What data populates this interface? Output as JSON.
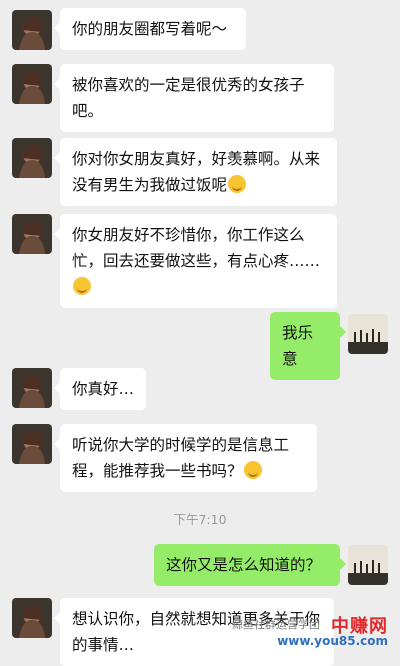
{
  "messages": [
    {
      "side": "in",
      "text": "你的朋友圈都写着呢～"
    },
    {
      "side": "in",
      "text": "被你喜欢的一定是很优秀的女孩子吧。"
    },
    {
      "side": "in",
      "text": "你对你女朋友真好，好羡慕啊。从来没有男生为我做过饭呢",
      "emoji": "embarrassed-emoji"
    },
    {
      "side": "in",
      "text": "你女朋友好不珍惜你，你工作这么忙，回去还要做这些，有点心疼……",
      "emoji": "sad-emoji"
    },
    {
      "side": "out",
      "text": "我乐意"
    },
    {
      "side": "in",
      "text": "你真好…"
    },
    {
      "side": "in",
      "text": "听说你大学的时候学的是信息工程，能推荐我一些书吗？",
      "emoji": "grin-emoji"
    },
    {
      "side": "out",
      "text": "这你又是怎么知道的？"
    },
    {
      "side": "in",
      "text": "想认识你，自然就想知道更多关于你的事情…"
    }
  ],
  "timestamp": "下午7:10",
  "watermark": {
    "brand": "中赚网",
    "url": "www.you85.com",
    "channel": "鲸鱼社群运营学团"
  },
  "colors": {
    "background": "#ededed",
    "incoming_bubble": "#ffffff",
    "outgoing_bubble": "#95ec69",
    "timestamp": "#9a9a9a"
  }
}
